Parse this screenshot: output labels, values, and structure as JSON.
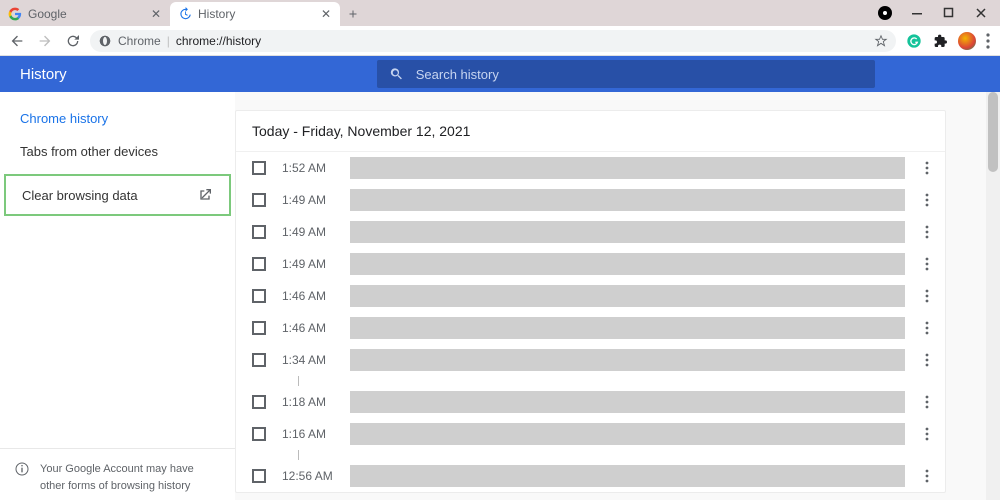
{
  "tabs": [
    {
      "title": "Google",
      "favicon": "google",
      "active": false
    },
    {
      "title": "History",
      "favicon": "history",
      "active": true
    }
  ],
  "omnibox": {
    "chip": "Chrome",
    "url": "chrome://history"
  },
  "header": {
    "title": "History",
    "search_placeholder": "Search history"
  },
  "sidebar": {
    "items": [
      {
        "label": "Chrome history",
        "active": true
      },
      {
        "label": "Tabs from other devices",
        "active": false
      }
    ],
    "clear_label": "Clear browsing data",
    "notice": "Your Google Account may have other forms of browsing history"
  },
  "history": {
    "date_label": "Today - Friday, November 12, 2021",
    "entries": [
      {
        "time": "1:52 AM"
      },
      {
        "time": "1:49 AM"
      },
      {
        "time": "1:49 AM"
      },
      {
        "time": "1:49 AM"
      },
      {
        "time": "1:46 AM"
      },
      {
        "time": "1:46 AM"
      },
      {
        "time": "1:34 AM",
        "tick": true
      },
      {
        "time": "1:18 AM"
      },
      {
        "time": "1:16 AM",
        "tick": true
      },
      {
        "time": "12:56 AM"
      }
    ]
  }
}
